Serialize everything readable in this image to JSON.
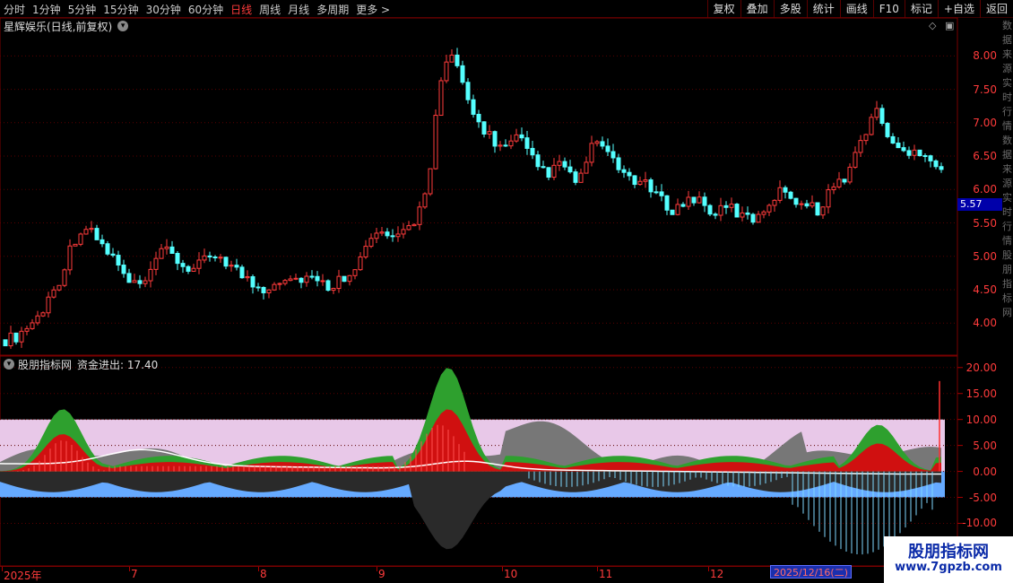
{
  "toolbar": {
    "periods": [
      {
        "label": "分时",
        "active": false
      },
      {
        "label": "1分钟",
        "active": false
      },
      {
        "label": "5分钟",
        "active": false
      },
      {
        "label": "15分钟",
        "active": false
      },
      {
        "label": "30分钟",
        "active": false
      },
      {
        "label": "60分钟",
        "active": false
      },
      {
        "label": "日线",
        "active": true
      },
      {
        "label": "周线",
        "active": false
      },
      {
        "label": "月线",
        "active": false
      },
      {
        "label": "多周期",
        "active": false
      },
      {
        "label": "更多 >",
        "active": false
      }
    ],
    "tools": [
      "复权",
      "叠加",
      "多股",
      "统计",
      "画线",
      "F10",
      "标记",
      "+自选",
      "返回"
    ]
  },
  "main_title": "星辉娱乐(日线,前复权)",
  "indicator_title": "股朋指标网",
  "indicator_value": "资金进出: 17.40",
  "current_price_tag": "5.57",
  "selected_date": "2025/12/16(二)",
  "right_strip_text": "数据来源实时行情数据来源实时行情股朋指标网",
  "watermark": {
    "name": "股朋指标网",
    "url": "www.7gpzb.com"
  },
  "colors": {
    "up": "#ff3b3b",
    "down": "#54ffff",
    "accent": "#ff3b3b",
    "band": "#e8c8e8",
    "blue": "#66aaff"
  },
  "chart_data": [
    {
      "type": "candlestick",
      "title": "星辉娱乐(日线,前复权)",
      "ylim": [
        3.6,
        8.3
      ],
      "yticks": [
        4.0,
        4.5,
        5.0,
        5.5,
        6.0,
        6.5,
        7.0,
        7.5,
        8.0
      ],
      "yticks_labels": [
        "4.00",
        "4.50",
        "5.00",
        "5.50",
        "6.00",
        "6.50",
        "7.00",
        "7.50",
        "8.00"
      ],
      "x_labels": [
        "2025年",
        "7",
        "8",
        "9",
        "10",
        "11",
        "12"
      ],
      "close_path": [
        3.75,
        3.8,
        3.95,
        4.1,
        4.4,
        4.7,
        5.2,
        5.45,
        5.3,
        5.1,
        4.9,
        4.6,
        4.55,
        4.7,
        5.1,
        5.0,
        4.85,
        4.8,
        4.95,
        5.05,
        4.9,
        4.75,
        4.6,
        4.5,
        4.6,
        4.7,
        4.65,
        4.7,
        4.6,
        4.55,
        4.65,
        4.8,
        5.0,
        5.3,
        5.35,
        5.2,
        5.4,
        5.6,
        6.2,
        7.6,
        8.0,
        7.6,
        7.1,
        6.9,
        6.7,
        6.6,
        6.8,
        6.5,
        6.3,
        6.25,
        6.4,
        6.1,
        6.3,
        6.8,
        6.5,
        6.3,
        6.2,
        6.1,
        6.0,
        5.8,
        5.7,
        5.8,
        5.9,
        5.7,
        5.65,
        5.75,
        5.6,
        5.55,
        5.7,
        5.9,
        6.0,
        5.85,
        5.75,
        5.7,
        6.0,
        6.1,
        6.4,
        6.8,
        7.2,
        6.9,
        6.6,
        6.5,
        6.6,
        6.5,
        6.3
      ]
    },
    {
      "type": "area",
      "title": "股朋指标网",
      "ylim": [
        -17,
        21
      ],
      "yticks": [
        20.0,
        15.0,
        10.0,
        5.0,
        0.0,
        -5.0,
        -10.0
      ],
      "yticks_labels": [
        "20.00",
        "15.00",
        "10.00",
        "5.00",
        "0.00",
        "-5.00",
        "-10.00"
      ],
      "band": [
        0,
        10
      ],
      "negative_band": [
        -5,
        0
      ],
      "last_value": 17.4
    }
  ]
}
